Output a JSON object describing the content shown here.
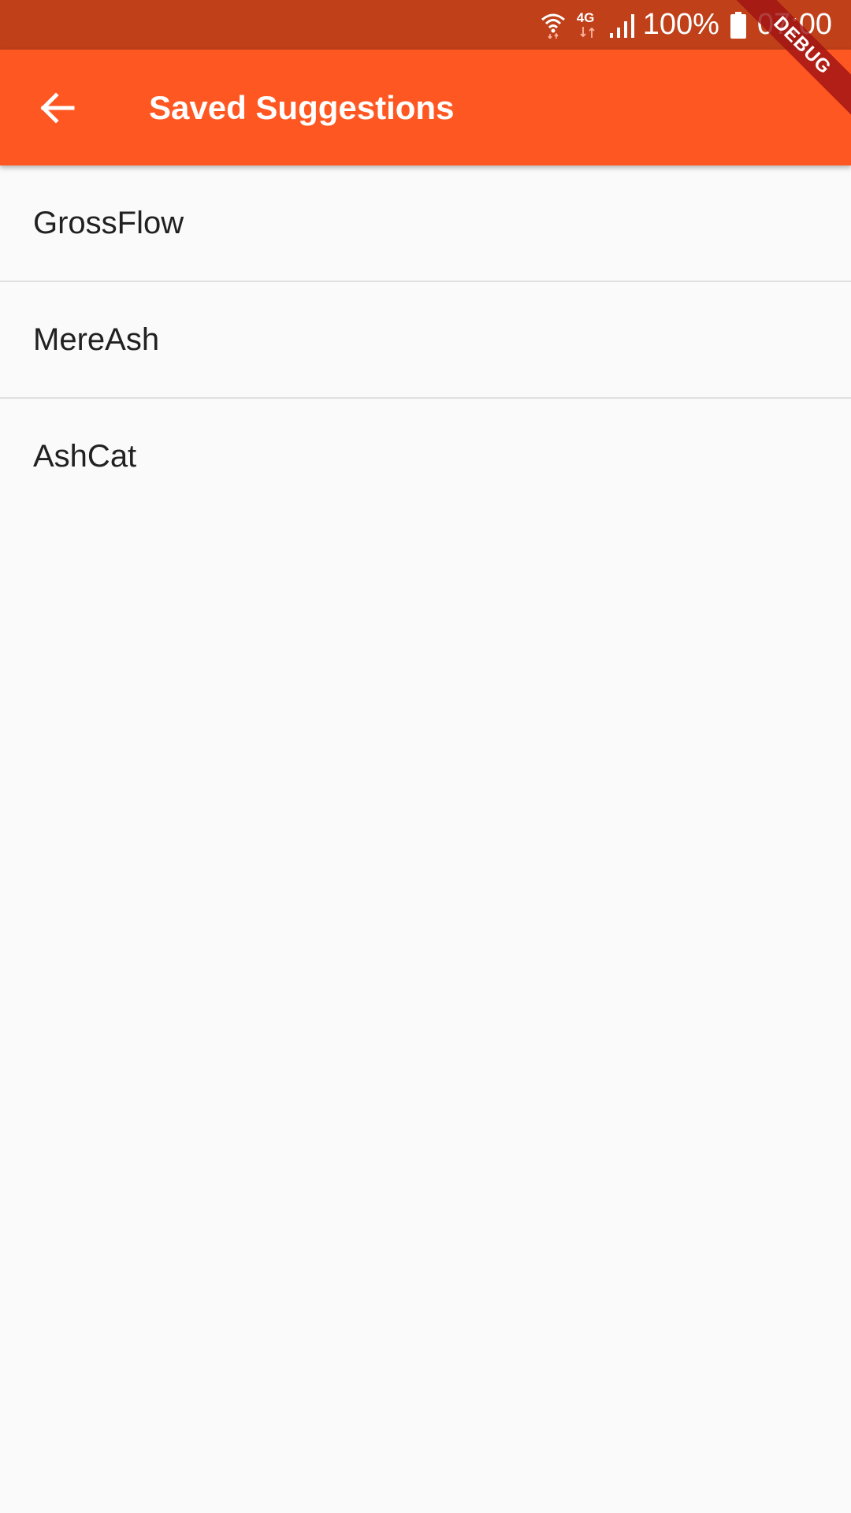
{
  "status_bar": {
    "network_type": "4G",
    "battery": "100%",
    "time": "07:00",
    "icons": [
      "wifi-icon",
      "data-arrows-icon",
      "signal-icon",
      "battery-icon"
    ]
  },
  "app_bar": {
    "back_icon": "arrow-back-icon",
    "title": "Saved Suggestions",
    "color": "#ff5722"
  },
  "saved_list": [
    {
      "label": "GrossFlow"
    },
    {
      "label": "MereAsh"
    },
    {
      "label": "AshCat"
    }
  ],
  "debug_banner": {
    "text": "DEBUG"
  },
  "colors": {
    "status_bar": "#bf4019",
    "app_bar": "#ff5722",
    "background": "#fafafa",
    "text": "#212121",
    "divider": "#e0e0e0"
  }
}
